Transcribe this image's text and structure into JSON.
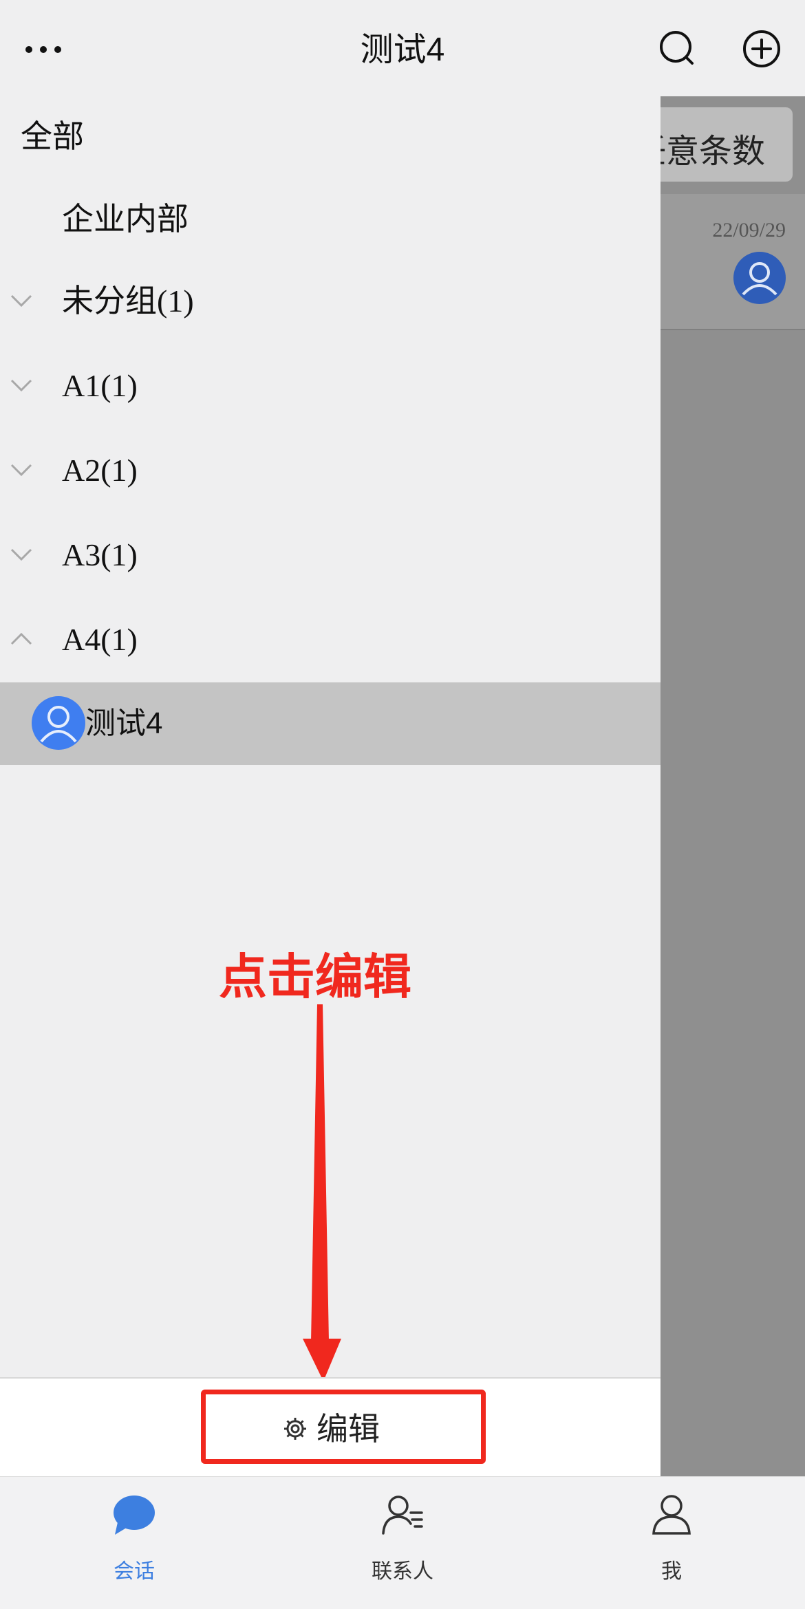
{
  "header": {
    "title": "测试4"
  },
  "background_page": {
    "filter_chip": "任意条数",
    "row_date": "22/09/29"
  },
  "drawer": {
    "all_label": "全部",
    "internal_label": "企业内部",
    "groups": [
      {
        "label": "未分组(1)",
        "expanded": false
      },
      {
        "label": "A1(1)",
        "expanded": false
      },
      {
        "label": "A2(1)",
        "expanded": false
      },
      {
        "label": "A3(1)",
        "expanded": false
      },
      {
        "label": "A4(1)",
        "expanded": true
      }
    ],
    "contact": {
      "name": "测试4"
    },
    "edit_label": "编辑"
  },
  "annotation": {
    "text": "点击编辑",
    "color": "#f0281e"
  },
  "tabbar": {
    "tabs": [
      {
        "label": "会话",
        "active": true
      },
      {
        "label": "联系人",
        "active": false
      },
      {
        "label": "我",
        "active": false
      }
    ],
    "active_color": "#3d7fe0",
    "inactive_color": "#333333"
  }
}
